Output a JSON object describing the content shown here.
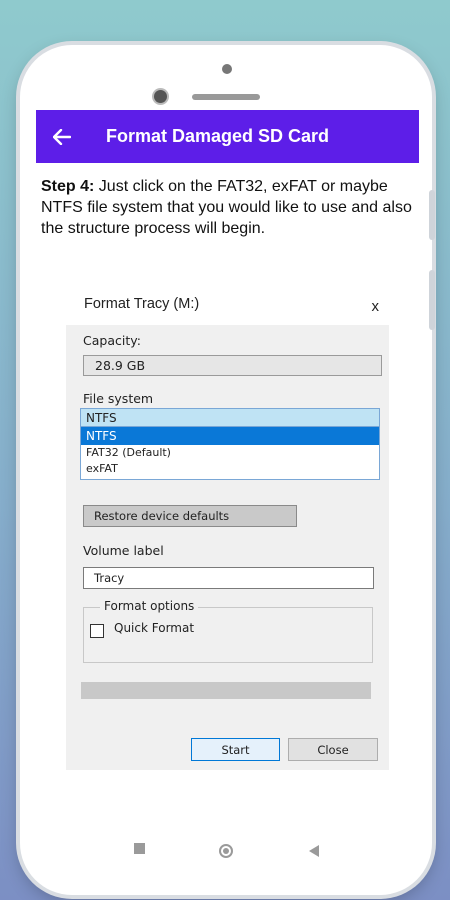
{
  "app_bar": {
    "title": "Format Damaged SD Card",
    "color": "#5d1ee8"
  },
  "instruction": {
    "step_label": "Step 4:",
    "text": " Just click on the FAT32, exFAT or maybe NTFS file system that you would like to use and also the structure process will begin."
  },
  "dialog": {
    "title": "Format Tracy (M:)",
    "close_glyph": "x",
    "capacity_label": "Capacity:",
    "capacity_value": "28.9 GB",
    "file_system_label": "File system",
    "file_system_options": [
      "NTFS",
      "NTFS",
      "FAT32 (Default)",
      "exFAT"
    ],
    "selected_option_color": "#0a78d7",
    "restore_button": "Restore device defaults",
    "volume_label": "Volume label",
    "volume_value": "Tracy",
    "format_options_label": "Format options",
    "quick_format_label": "Quick Format",
    "quick_format_checked": false,
    "progress": 0,
    "start_button": "Start",
    "close_button": "Close"
  },
  "navigation": {
    "recents": "square-icon",
    "home": "circle-icon",
    "back": "triangle-back-icon"
  }
}
